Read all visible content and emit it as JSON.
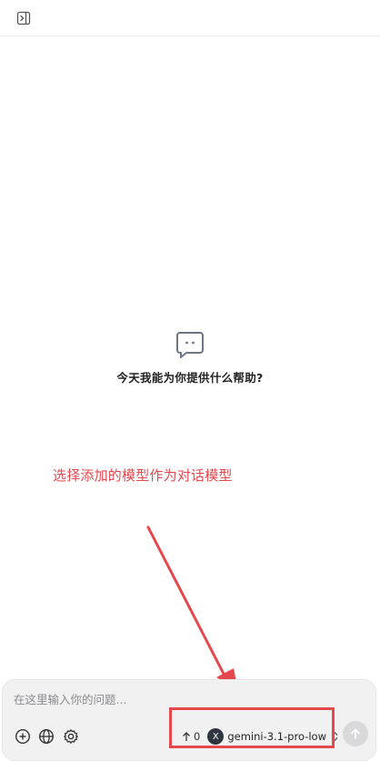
{
  "header": {
    "sidebar_toggle_icon": "sidebar-expand-icon"
  },
  "empty_state": {
    "icon": "chat-bubble-icon",
    "title": "今天我能为你提供什么帮助?"
  },
  "annotation": {
    "text": "选择添加的模型作为对话模型",
    "color": "#e5484d"
  },
  "composer": {
    "placeholder": "在这里输入你的问题...",
    "tools": [
      "add-icon",
      "globe-icon",
      "settings-icon"
    ],
    "token_count": "0",
    "model_avatar_letter": "X",
    "model_name": "gemini-3.1-pro-low",
    "send_icon": "arrow-up-icon"
  }
}
